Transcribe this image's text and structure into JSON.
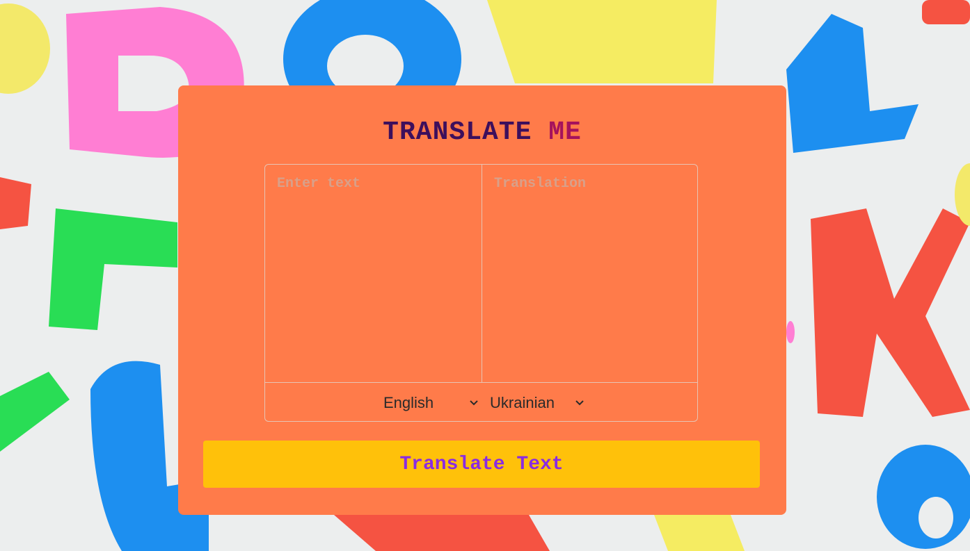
{
  "title": {
    "word1": "TRANSLATE",
    "word2": "ME"
  },
  "input": {
    "placeholder": "Enter text",
    "value": ""
  },
  "output": {
    "placeholder": "Translation",
    "value": ""
  },
  "languages": {
    "from": "English",
    "to": "Ukrainian"
  },
  "button": {
    "label": "Translate Text"
  },
  "colors": {
    "card": "#ff7b4a",
    "title_primary": "#3d0f5c",
    "title_accent": "#a5125c",
    "button_bg": "#ffc10a",
    "button_text": "#8a2be2"
  },
  "icons": {
    "dropdown": "chevron-down-icon"
  }
}
